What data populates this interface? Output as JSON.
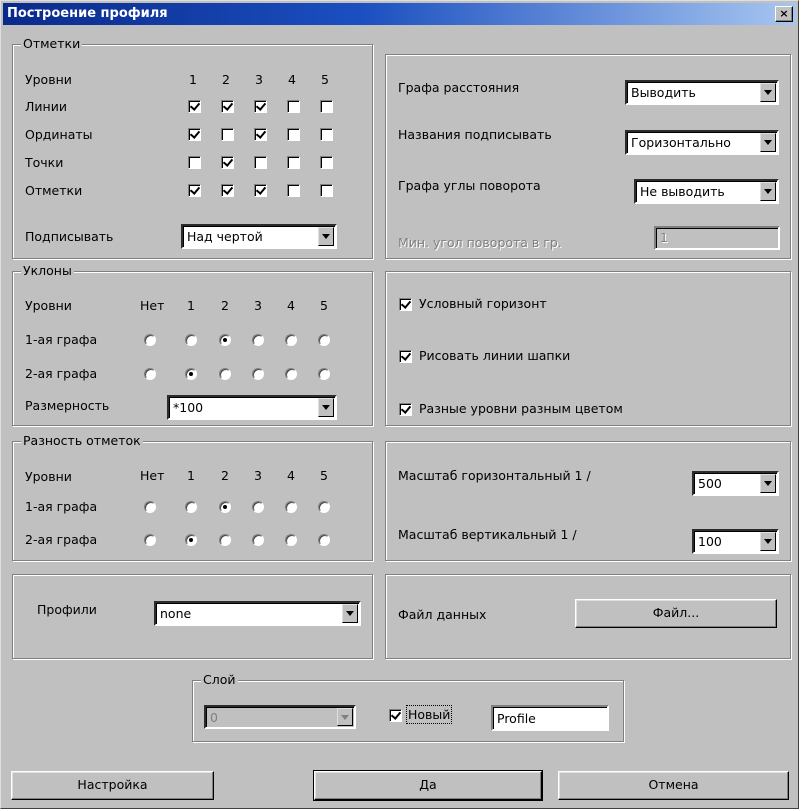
{
  "window": {
    "title": "Построение профиля",
    "close_glyph": "×"
  },
  "marks": {
    "legend": "Отметки",
    "levels_label": "Уровни",
    "level_numbers": [
      "1",
      "2",
      "3",
      "4",
      "5"
    ],
    "rows": [
      {
        "label": "Линии",
        "checks": [
          true,
          true,
          true,
          false,
          false
        ]
      },
      {
        "label": "Ординаты",
        "checks": [
          true,
          false,
          true,
          false,
          false
        ]
      },
      {
        "label": "Точки",
        "checks": [
          false,
          true,
          false,
          false,
          false
        ]
      },
      {
        "label": "Отметки",
        "checks": [
          true,
          true,
          true,
          false,
          false
        ]
      }
    ],
    "sign_label": "Подписывать",
    "sign_value": "Над чертой"
  },
  "graphs": {
    "distance_label": "Графа расстояния",
    "distance_value": "Выводить",
    "names_label": "Названия подписывать",
    "names_value": "Горизонтально",
    "angles_label": "Графа углы поворота",
    "angles_value": "Не выводить",
    "min_angle_label": "Мин. угол поворота в гр.",
    "min_angle_value": "1"
  },
  "slopes": {
    "legend": "Уклоны",
    "levels_label": "Уровни",
    "columns": [
      "Нет",
      "1",
      "2",
      "3",
      "4",
      "5"
    ],
    "rows": [
      {
        "label": "1-ая графа",
        "selected": 2
      },
      {
        "label": "2-ая графа",
        "selected": 1
      }
    ],
    "dimension_label": "Размерность",
    "dimension_value": "*100"
  },
  "options": {
    "items": [
      {
        "label": "Условный горизонт",
        "checked": true
      },
      {
        "label": "Рисовать линии шапки",
        "checked": true
      },
      {
        "label": "Разные уровни разным цветом",
        "checked": true
      }
    ]
  },
  "diff": {
    "legend": "Разность отметок",
    "levels_label": "Уровни",
    "columns": [
      "Нет",
      "1",
      "2",
      "3",
      "4",
      "5"
    ],
    "rows": [
      {
        "label": "1-ая графа",
        "selected": 2
      },
      {
        "label": "2-ая графа",
        "selected": 1
      }
    ]
  },
  "scale": {
    "horizontal_label": "Масштаб горизонтальный 1 /",
    "horizontal_value": "500",
    "vertical_label": "Масштаб вертикальный 1 /",
    "vertical_value": "100"
  },
  "profiles": {
    "label": "Профили",
    "value": "none"
  },
  "datafile": {
    "label": "Файл данных",
    "button": "Файл..."
  },
  "layer": {
    "legend": "Слой",
    "combo_value": "0",
    "new_label": "Новый",
    "new_checked": true,
    "name_value": "Profile"
  },
  "buttons": {
    "settings": "Настройка",
    "ok": "Да",
    "cancel": "Отмена"
  }
}
